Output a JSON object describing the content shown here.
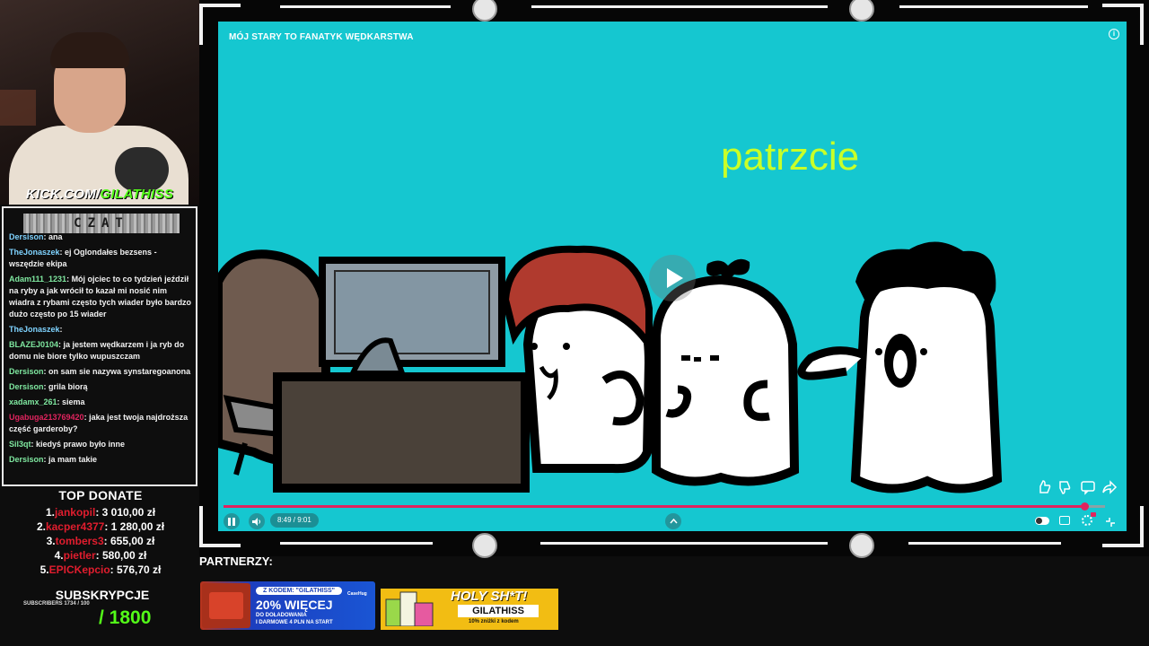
{
  "webcam": {
    "link_prefix": "KICK.COM/",
    "link_name": "GILATHISS"
  },
  "chat": {
    "header": "CZAT",
    "messages": [
      {
        "user": "Dersison",
        "text": "ana",
        "color": "#7fd3ff"
      },
      {
        "user": "TheJonaszek",
        "text": "ej Oglondałes bezsens - wszędzie ekipa",
        "color": "#7fd3ff"
      },
      {
        "user": "Adam111_1231",
        "text": "Mój ojciec to co tydzień jeździł na ryby a jak wrócił to kazał mi nosić nim wiadra z rybami często tych wiader było bardzo dużo często po 15 wiader",
        "color": "#7fe8a0"
      },
      {
        "user": "TheJonaszek",
        "text": "",
        "color": "#7fd3ff"
      },
      {
        "user": "BLAZEJ0104",
        "text": "ja jestem wędkarzem i ja ryb do domu nie biore tylko wupuszczam",
        "color": "#7fe8a0"
      },
      {
        "user": "Dersison",
        "text": "on sam sie nazywa synstaregoanona",
        "color": "#7fe8a0"
      },
      {
        "user": "Dersison",
        "text": "grila biorą",
        "color": "#7fe8a0"
      },
      {
        "user": "xadamx_261",
        "text": "siema",
        "color": "#7fe8a0"
      },
      {
        "user": "Ugabuga213769420",
        "text": "jaka jest twoja najdroższa część garderoby?",
        "color": "#e0245e"
      },
      {
        "user": "Sil3qt",
        "text": "kiedyś prawo było inne",
        "color": "#7fe8a0"
      },
      {
        "user": "Dersison",
        "text": "ja mam takie",
        "color": "#7fe8a0"
      }
    ]
  },
  "donate": {
    "title": "TOP DONATE",
    "entries": [
      {
        "rank": "1.",
        "name": "jankopil",
        "amount": ": 3 010,00 zł"
      },
      {
        "rank": "2.",
        "name": "kacper4377",
        "amount": ": 1 280,00 zł"
      },
      {
        "rank": "3.",
        "name": "tombers3",
        "amount": ": 655,00 zł"
      },
      {
        "rank": "4.",
        "name": "pietler",
        "amount": ": 580,00 zł"
      },
      {
        "rank": "5.",
        "name": "EPICKepcio",
        "amount": ": 576,70 zł"
      }
    ]
  },
  "subs": {
    "title": "SUBSKRYPCJE",
    "small": "SUBSCRIBERS 1734 / 100",
    "goal": "/ 1800"
  },
  "video": {
    "title": "MÓJ STARY TO FANATYK WĘDKARSTWA",
    "subtitle": "patrzcie",
    "time": "8:49 / 9:01",
    "progress": 0.977,
    "info_icon": "i"
  },
  "partners": {
    "label": "PARTNERZY:",
    "case": {
      "code": "Z KODEM: \"GILATHISS\"",
      "big": "20% WIĘCEJ",
      "small": "DO DOŁADOWANIA",
      "mid": "I DARMOWE 4 PLN NA START",
      "logo": "CaseHug"
    },
    "holy": {
      "title": "HOLY SH*T!",
      "code": "GILATHISS",
      "small": "10% zniżki z kodem"
    }
  },
  "colors": {
    "accent": "#53fc18",
    "video_bg": "#15c7d0",
    "subtitle": "#c9ff28",
    "progress": "#e0245e"
  }
}
